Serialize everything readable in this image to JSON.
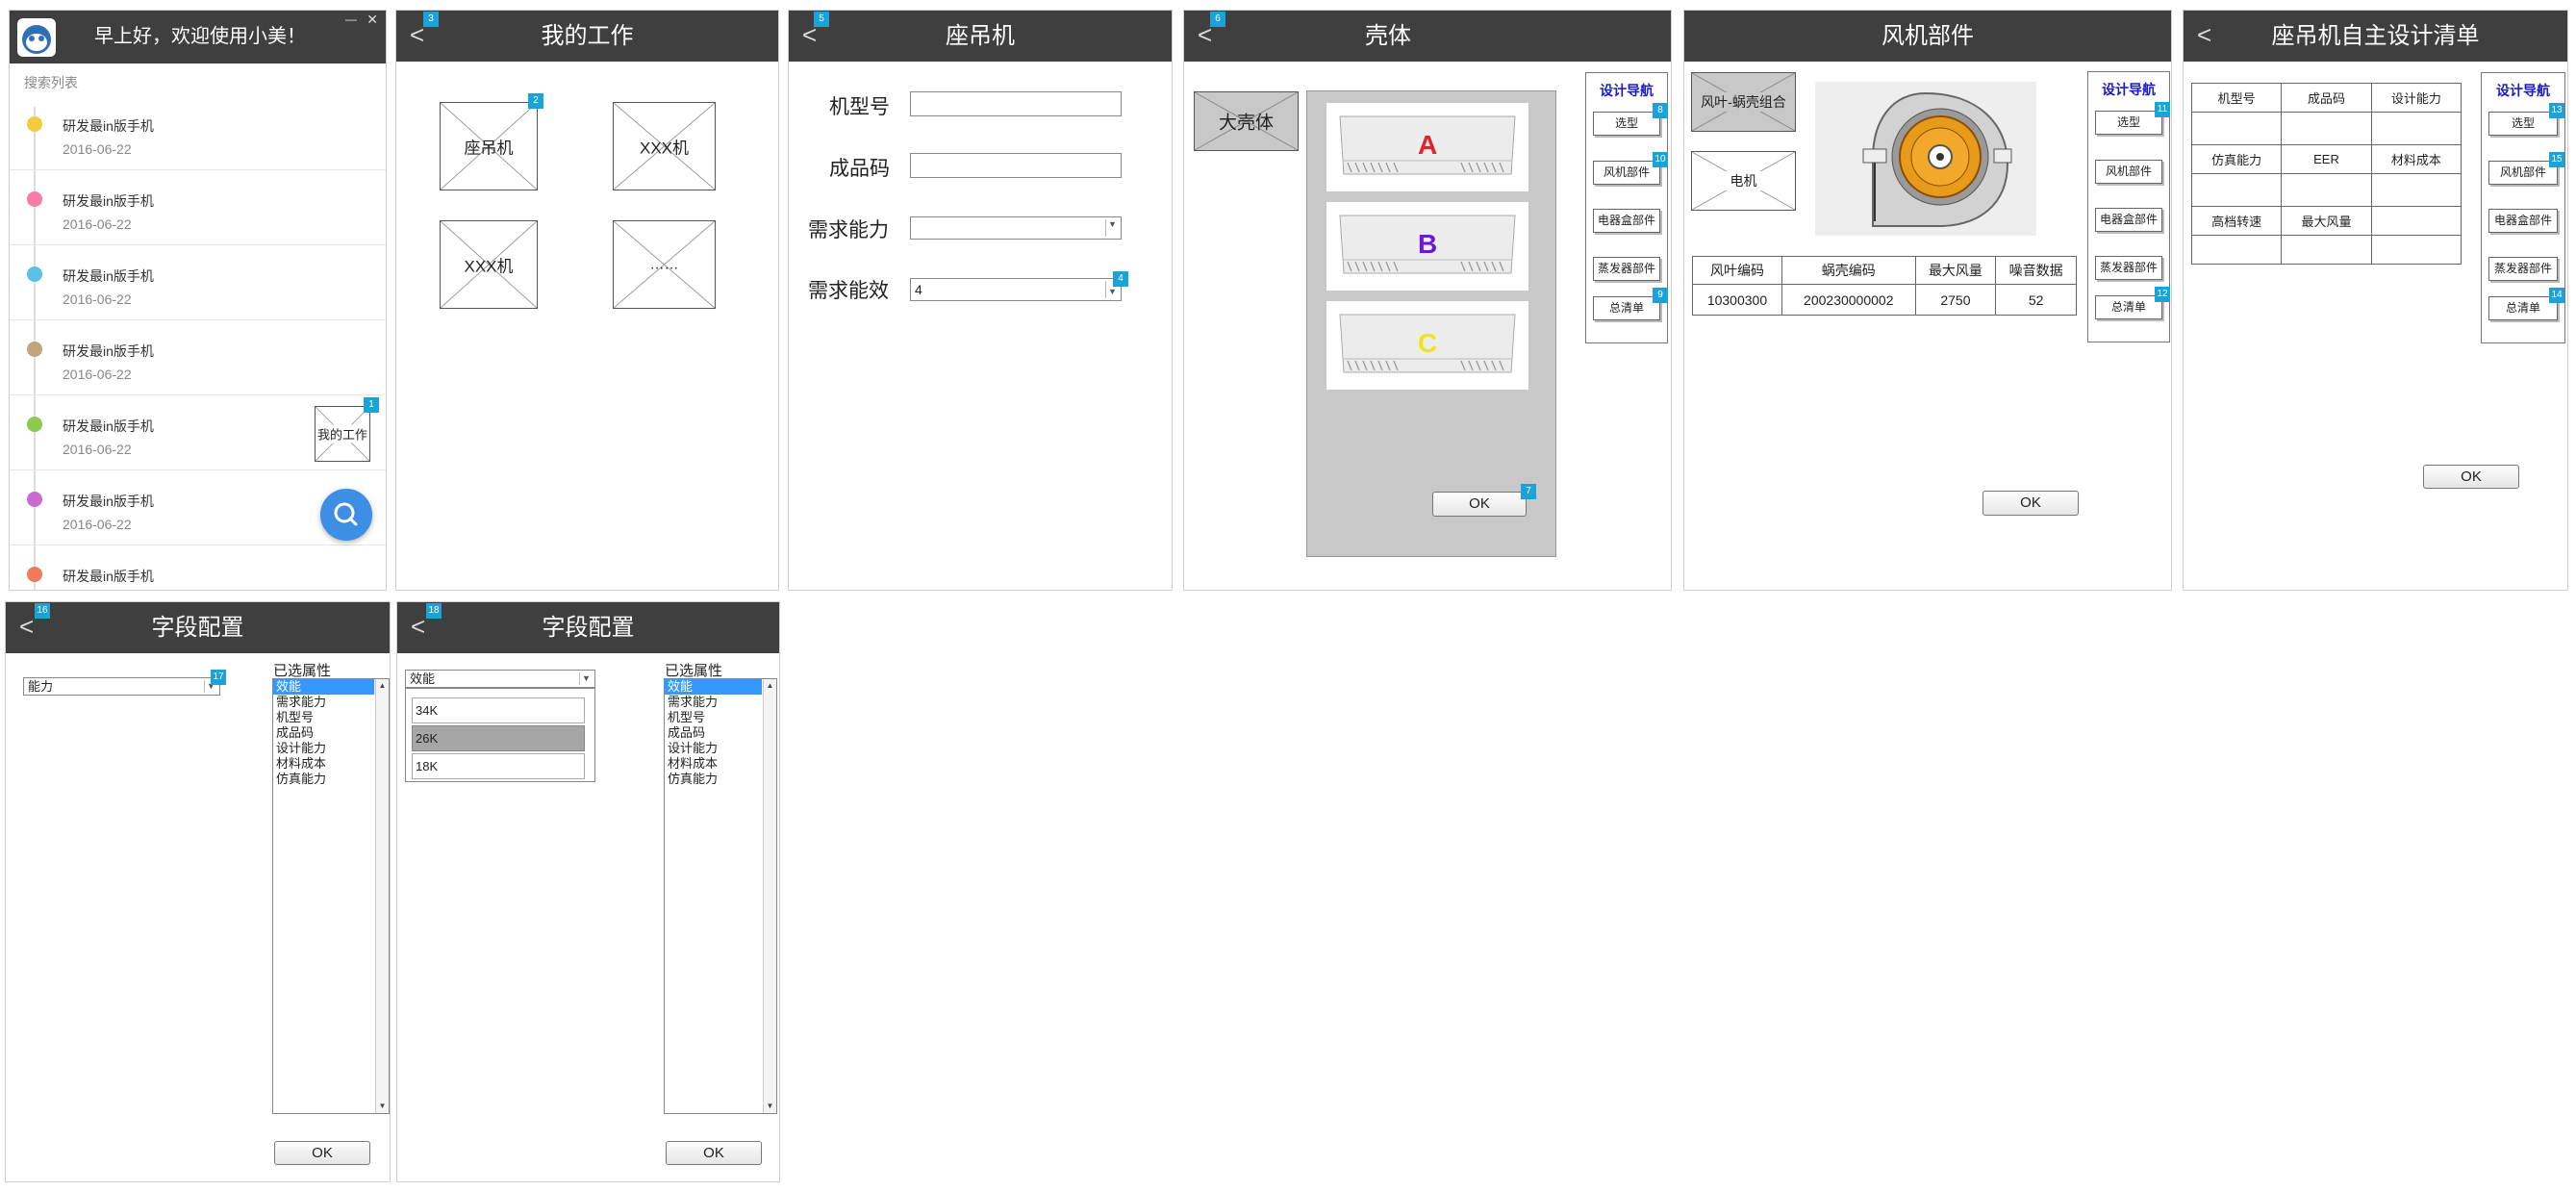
{
  "home": {
    "greeting": "早上好，欢迎使用小美！",
    "minimize": "—",
    "close": "✕",
    "search_list_label": "搜索列表",
    "items": [
      {
        "title": "研发最in版手机",
        "date": "2016-06-22",
        "color": "#f5cb3c"
      },
      {
        "title": "研发最in版手机",
        "date": "2016-06-22",
        "color": "#f77ca6"
      },
      {
        "title": "研发最in版手机",
        "date": "2016-06-22",
        "color": "#5cc0e8"
      },
      {
        "title": "研发最in版手机",
        "date": "2016-06-22",
        "color": "#c0a47c"
      },
      {
        "title": "研发最in版手机",
        "date": "2016-06-22",
        "color": "#8dc84f"
      },
      {
        "title": "研发最in版手机",
        "date": "2016-06-22",
        "color": "#c86ad0"
      },
      {
        "title": "研发最in版手机",
        "date": "",
        "color": "#f07a5a"
      }
    ],
    "my_work_label": "我的工作",
    "badge": "1"
  },
  "mywork": {
    "title": "我的工作",
    "back": "<",
    "badge_back": "3",
    "badge_item": "2",
    "tiles": [
      "座吊机",
      "XXX机",
      "XXX机",
      "……"
    ]
  },
  "zuodiao": {
    "title": "座吊机",
    "back": "<",
    "badge_back": "5",
    "badge_dd": "4",
    "fields": {
      "model": "机型号",
      "product_code": "成品码",
      "capacity": "需求能力",
      "efficiency": "需求能效",
      "efficiency_value": "4"
    }
  },
  "shell": {
    "title": "壳体",
    "back": "<",
    "badge_back": "6",
    "big_shell": "大壳体",
    "options": [
      {
        "letter": "A",
        "color": "#e8202a"
      },
      {
        "letter": "B",
        "color": "#6a1ad0"
      },
      {
        "letter": "C",
        "color": "#f0e41a"
      }
    ],
    "ok": "OK",
    "badge_ok": "7",
    "nav": {
      "title": "设计导航",
      "items": [
        "选型",
        "风机部件",
        "电器盒部件",
        "蒸发器部件",
        "总清单"
      ],
      "badges": [
        "8",
        "10",
        "",
        "",
        "9"
      ]
    }
  },
  "fan": {
    "title": "风机部件",
    "tiles": [
      "风叶-蜗壳组合",
      "电机"
    ],
    "table_header": [
      "风叶编码",
      "蜗壳编码",
      "最大风量",
      "噪音数据"
    ],
    "table_row": [
      "10300300",
      "200230000002",
      "2750",
      "52"
    ],
    "ok": "OK",
    "nav": {
      "title": "设计导航",
      "items": [
        "选型",
        "风机部件",
        "电器盒部件",
        "蒸发器部件",
        "总清单"
      ],
      "badges": [
        "11",
        "",
        "",
        "",
        "12"
      ]
    }
  },
  "checklist": {
    "title": "座吊机自主设计清单",
    "back": "<",
    "rows": [
      [
        "机型号",
        "成品码",
        "设计能力"
      ],
      [
        "",
        "",
        ""
      ],
      [
        "仿真能力",
        "EER",
        "材料成本"
      ],
      [
        "",
        "",
        ""
      ],
      [
        "高档转速",
        "最大风量",
        ""
      ],
      [
        "",
        "",
        ""
      ]
    ],
    "ok": "OK",
    "nav": {
      "title": "设计导航",
      "items": [
        "选型",
        "风机部件",
        "电器盒部件",
        "蒸发器部件",
        "总清单"
      ],
      "badges": [
        "13",
        "15",
        "",
        "",
        "14"
      ]
    }
  },
  "field1": {
    "title": "字段配置",
    "back": "<",
    "badge_back": "16",
    "badge_dd": "17",
    "dropdown_value": "能力",
    "selected_label": "已选属性",
    "attrs": [
      "效能",
      "需求能力",
      "机型号",
      "成品码",
      "设计能力",
      "材料成本",
      "仿真能力"
    ],
    "ok": "OK"
  },
  "field2": {
    "title": "字段配置",
    "back": "<",
    "badge_back": "18",
    "dropdown_value": "效能",
    "options": [
      "34K",
      "26K",
      "18K"
    ],
    "selected_label": "已选属性",
    "attrs": [
      "效能",
      "需求能力",
      "机型号",
      "成品码",
      "设计能力",
      "材料成本",
      "仿真能力"
    ],
    "ok": "OK"
  }
}
